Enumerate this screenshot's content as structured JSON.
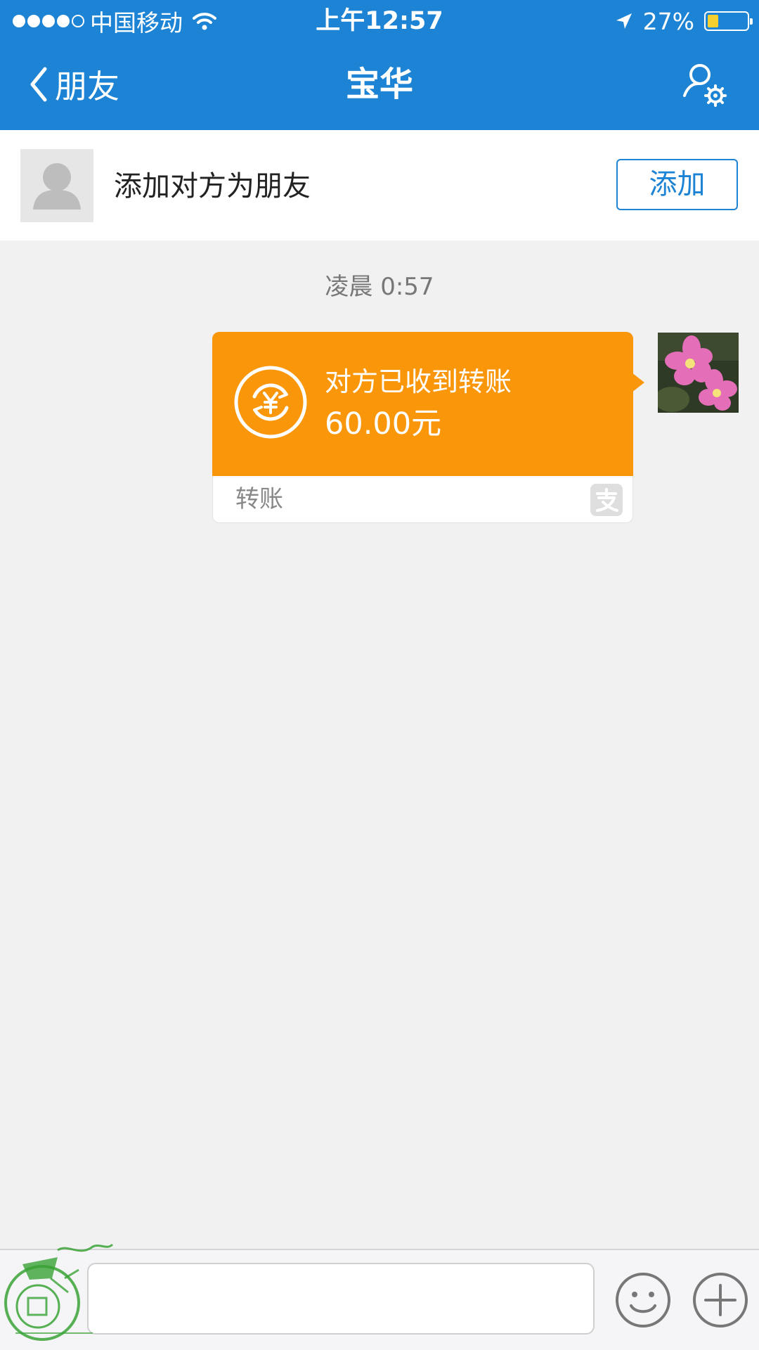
{
  "status_bar": {
    "carrier": "中国移动",
    "time": "上午12:57",
    "battery_percent": "27%",
    "battery_level": 0.27,
    "signal_bars": 4
  },
  "nav": {
    "back_label": "朋友",
    "title": "宝华"
  },
  "add_friend": {
    "text": "添加对方为朋友",
    "button": "添加"
  },
  "chat": {
    "timestamp": "凌晨 0:57",
    "transfer": {
      "status": "对方已收到转账",
      "amount": "60.00元",
      "label": "转账"
    }
  },
  "input": {
    "placeholder": ""
  },
  "colors": {
    "primary": "#1d83d4",
    "transfer_orange": "#fa960a",
    "background": "#f1f1f1"
  },
  "icons": [
    "chevron-left-icon",
    "profile-settings-icon",
    "transfer-yuan-icon",
    "alipay-icon",
    "emoji-icon",
    "plus-icon",
    "wifi-icon",
    "location-arrow-icon"
  ]
}
